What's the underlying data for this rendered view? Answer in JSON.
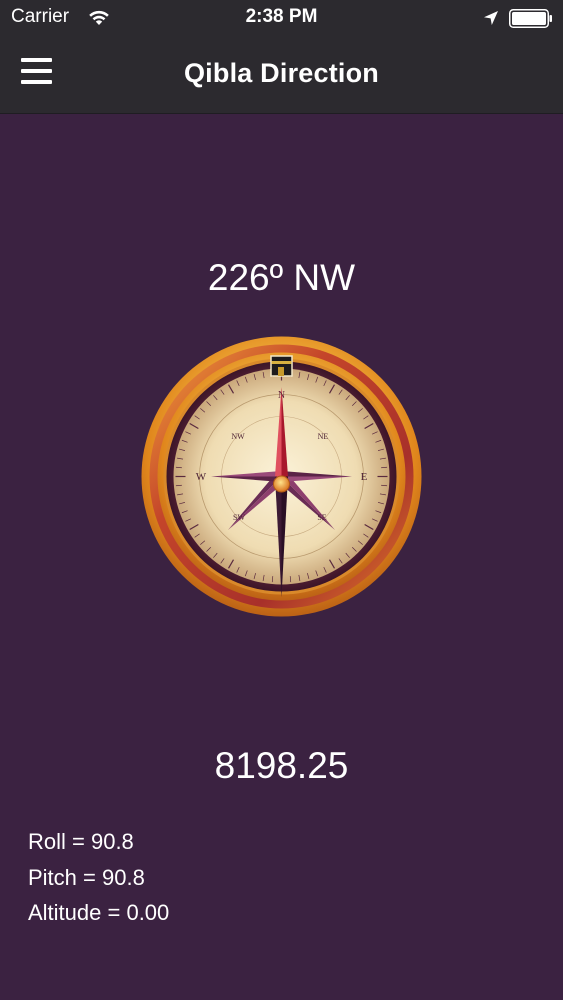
{
  "status_bar": {
    "carrier": "Carrier",
    "time": "2:38 PM",
    "icons": [
      "wifi-icon",
      "location-arrow-icon",
      "battery-icon"
    ]
  },
  "nav": {
    "menu_icon": "hamburger-menu-icon",
    "title": "Qibla Direction"
  },
  "compass": {
    "heading_text": "226º NW",
    "cardinals": {
      "n": "N",
      "e": "E",
      "s": "S",
      "w": "W"
    },
    "intercardinals": {
      "ne": "NE",
      "nw": "NW",
      "se": "SE",
      "sw": "SW"
    },
    "marker_icon": "kaaba-icon"
  },
  "distance": "8198.25",
  "sensors": {
    "roll": "Roll = 90.8",
    "pitch": "Pitch = 90.8",
    "altitude": "Altitude = 0.00"
  },
  "colors": {
    "background": "#3b2241",
    "bar": "#2c2a2f",
    "ring_gold": "#e8a52a",
    "ring_red": "#b43a2a",
    "needle_red": "#b8283c",
    "face": "#efe0bd"
  }
}
